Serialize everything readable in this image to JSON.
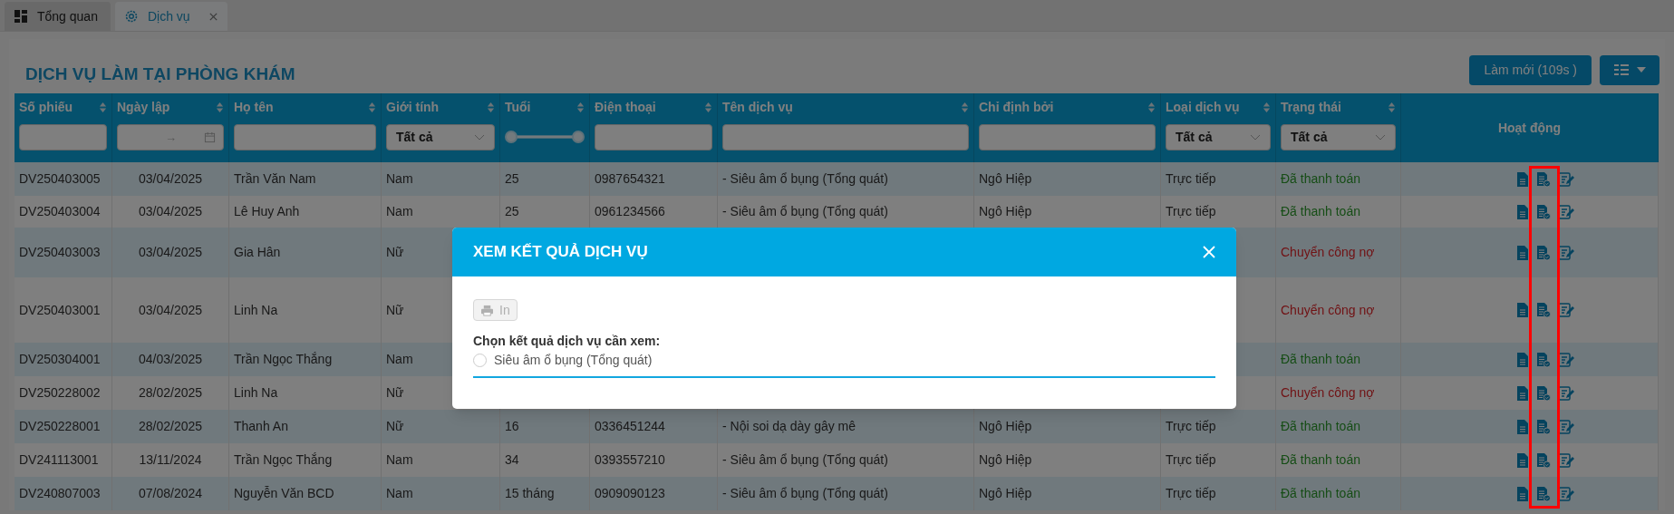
{
  "tabs": [
    {
      "label": "Tổng quan",
      "selected": false,
      "closable": false
    },
    {
      "label": "Dịch vụ",
      "selected": true,
      "closable": true
    }
  ],
  "page": {
    "title": "DỊCH VỤ LÀM TẠI PHÒNG KHÁM",
    "refresh_button": "Làm mới (109s )"
  },
  "table": {
    "columns": [
      {
        "label": "Số phiếu",
        "sortable": true,
        "filter": {
          "kind": "text"
        }
      },
      {
        "label": "Ngày lập",
        "sortable": true,
        "filter": {
          "kind": "date",
          "separator": "→"
        }
      },
      {
        "label": "Họ tên",
        "sortable": true,
        "filter": {
          "kind": "text"
        }
      },
      {
        "label": "Giới tính",
        "sortable": true,
        "filter": {
          "kind": "select",
          "value": "Tất cả"
        }
      },
      {
        "label": "Tuổi",
        "sortable": true,
        "filter": {
          "kind": "range",
          "level": 1
        }
      },
      {
        "label": "Điện thoại",
        "sortable": true,
        "filter": {
          "kind": "text"
        }
      },
      {
        "label": "Tên dịch vụ",
        "sortable": true,
        "filter": {
          "kind": "text"
        }
      },
      {
        "label": "Chỉ định bởi",
        "sortable": true,
        "filter": {
          "kind": "text"
        }
      },
      {
        "label": "Loại dịch vụ",
        "sortable": true,
        "filter": {
          "kind": "select",
          "value": "Tất cả"
        }
      },
      {
        "label": "Trạng thái",
        "sortable": true,
        "filter": {
          "kind": "select",
          "value": "Tất cả"
        }
      },
      {
        "label": "Hoạt động",
        "sortable": false,
        "filter": {
          "kind": "none"
        }
      }
    ],
    "rows": [
      {
        "cells": [
          "DV250403005",
          "03/04/2025",
          "Trần Văn Nam",
          "Nam",
          "25",
          "0987654321",
          "- Siêu âm ổ bụng (Tổng quát)",
          "Ngô Hiệp",
          "Trực tiếp"
        ],
        "status": {
          "text": "Đã thanh toán",
          "kind": "paid"
        }
      },
      {
        "cells": [
          "DV250403004",
          "03/04/2025",
          "Lê Huy Anh",
          "Nam",
          "25",
          "0961234566",
          "- Siêu âm ổ bụng (Tổng quát)",
          "Ngô Hiệp",
          "Trực tiếp"
        ],
        "status": {
          "text": "Đã thanh toán",
          "kind": "paid"
        }
      },
      {
        "cells": [
          "DV250403003",
          "03/04/2025",
          "Gia Hân",
          "Nữ"
        ],
        "status": {
          "text": "Chuyển công nợ",
          "kind": "debt"
        }
      },
      {
        "cells": [
          "DV250403001",
          "03/04/2025",
          "Linh Na",
          "Nữ"
        ],
        "status": {
          "text": "Chuyển công nợ",
          "kind": "debt"
        }
      },
      {
        "cells": [
          "DV250304001",
          "04/03/2025",
          "Trần Ngọc Thắng",
          "Nam"
        ],
        "status": {
          "text": "Đã thanh toán",
          "kind": "paid"
        }
      },
      {
        "cells": [
          "DV250228002",
          "28/02/2025",
          "Linh Na",
          "Nữ"
        ],
        "status": {
          "text": "Chuyển công nợ",
          "kind": "debt"
        }
      },
      {
        "cells": [
          "DV250228001",
          "28/02/2025",
          "Thanh An",
          "Nữ",
          "16",
          "0336451244",
          "- Nội soi dạ dày gây mê",
          "Ngô Hiệp",
          "Trực tiếp"
        ],
        "status": {
          "text": "Đã thanh toán",
          "kind": "paid"
        }
      },
      {
        "cells": [
          "DV241113001",
          "13/11/2024",
          "Trần Ngọc Thắng",
          "Nam",
          "34",
          "0393557210",
          "- Siêu âm ổ bụng (Tổng quát)",
          "Ngô Hiệp",
          "Trực tiếp"
        ],
        "status": {
          "text": "Đã thanh toán",
          "kind": "paid"
        }
      },
      {
        "cells": [
          "DV240807003",
          "07/08/2024",
          "Nguyễn Văn BCD",
          "Nam",
          "15 tháng",
          "0909090123",
          "- Siêu âm ổ bụng (Tổng quát)",
          "Ngô Hiệp",
          "Trực tiếp"
        ],
        "status": {
          "text": "Đã thanh toán",
          "kind": "paid"
        }
      }
    ]
  },
  "annotation": {
    "kind": "frame",
    "color": "#ff0000"
  },
  "modal": {
    "title": "XEM KẾT QUẢ DỊCH VỤ",
    "print_button": {
      "label": "In",
      "disabled": true
    },
    "prompt": "Chọn kết quả dịch vụ cần xem:",
    "options": [
      {
        "label": "Siêu âm ổ bụng (Tổng quát)",
        "selected": false
      }
    ]
  }
}
